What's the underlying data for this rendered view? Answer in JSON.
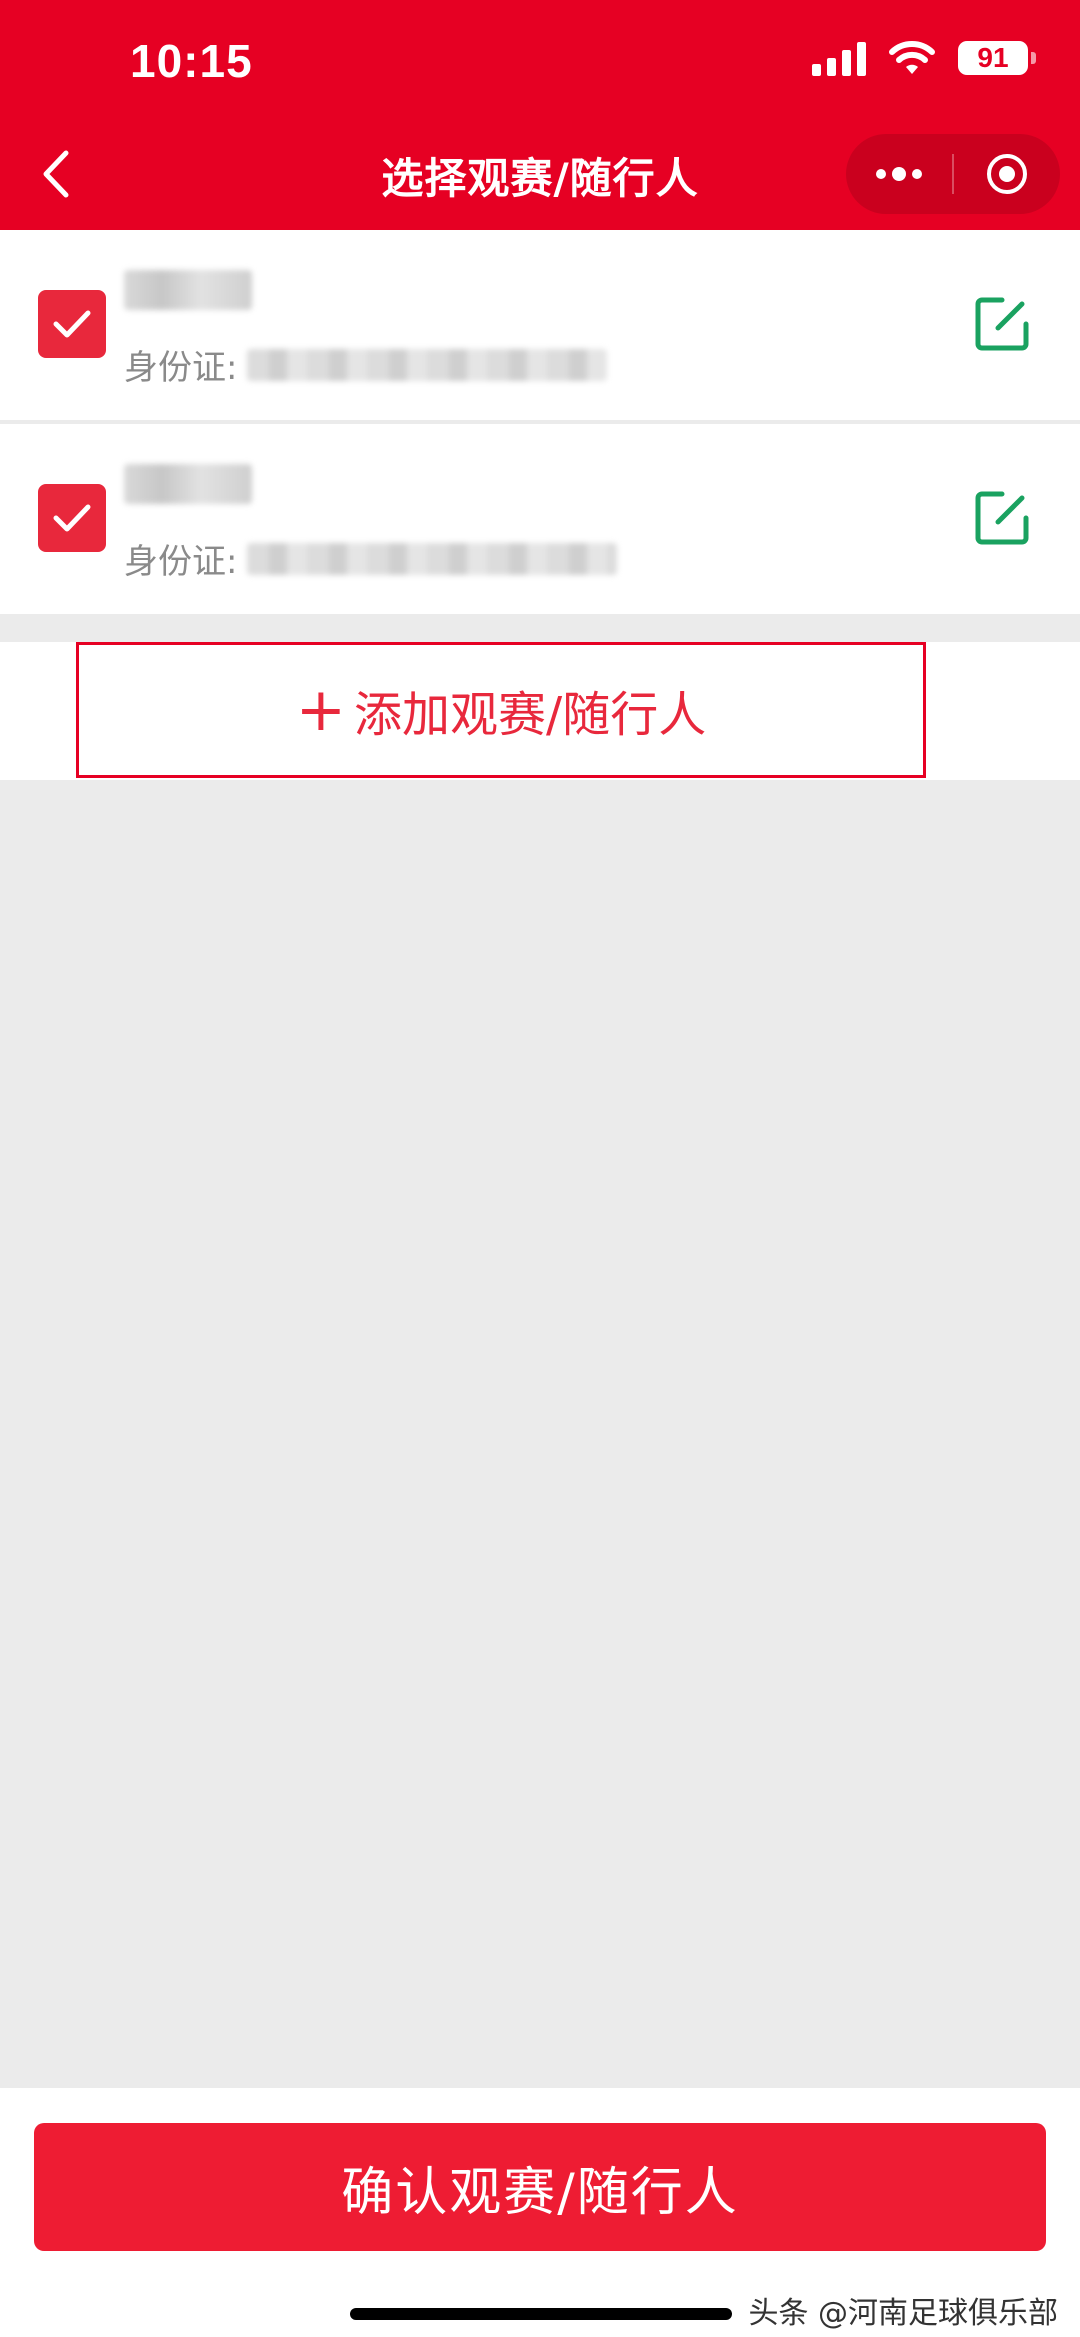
{
  "status_bar": {
    "time": "10:15",
    "battery": "91"
  },
  "nav": {
    "title": "选择观赛/随行人"
  },
  "persons": [
    {
      "id_label": "身份证:",
      "checked": true
    },
    {
      "id_label": "身份证:",
      "checked": true
    }
  ],
  "add_button": {
    "plus": "+",
    "label": "添加观赛/随行人"
  },
  "confirm_button": {
    "label": "确认观赛/随行人"
  },
  "watermark": "头条 @河南足球俱乐部",
  "colors": {
    "brand_red": "#e60023",
    "checkbox_red": "#e8283c",
    "edit_green": "#1aa260"
  }
}
